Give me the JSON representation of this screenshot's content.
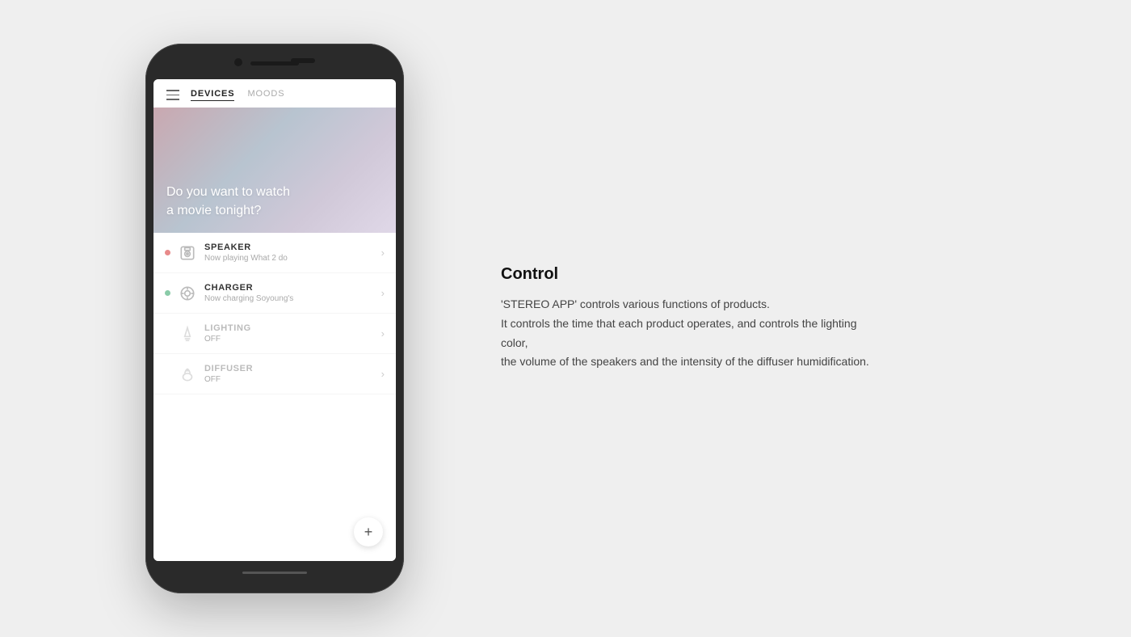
{
  "page": {
    "background": "#efefef"
  },
  "app": {
    "nav": {
      "devices_label": "DEVICES",
      "moods_label": "MOODS"
    },
    "hero": {
      "text_line1": "Do you want to watch",
      "text_line2": "a movie tonight?"
    },
    "devices": [
      {
        "id": "speaker",
        "name": "SPEAKER",
        "status": "Now playing What 2 do",
        "active": true,
        "dot_color": "on"
      },
      {
        "id": "charger",
        "name": "CHARGER",
        "status": "Now charging Soyoung's",
        "active": true,
        "dot_color": "on-green"
      },
      {
        "id": "lighting",
        "name": "LIGHTING",
        "status": "OFF",
        "active": false,
        "dot_color": "off"
      },
      {
        "id": "diffuser",
        "name": "DIFFUSER",
        "status": "OFF",
        "active": false,
        "dot_color": "off"
      }
    ],
    "fab_label": "+"
  },
  "description": {
    "title": "Control",
    "body_line1": "'STEREO APP' controls various functions of products.",
    "body_line2": "It controls the time that each product operates, and controls the lighting color,",
    "body_line3": "the volume of the speakers and the intensity of the diffuser humidification."
  }
}
